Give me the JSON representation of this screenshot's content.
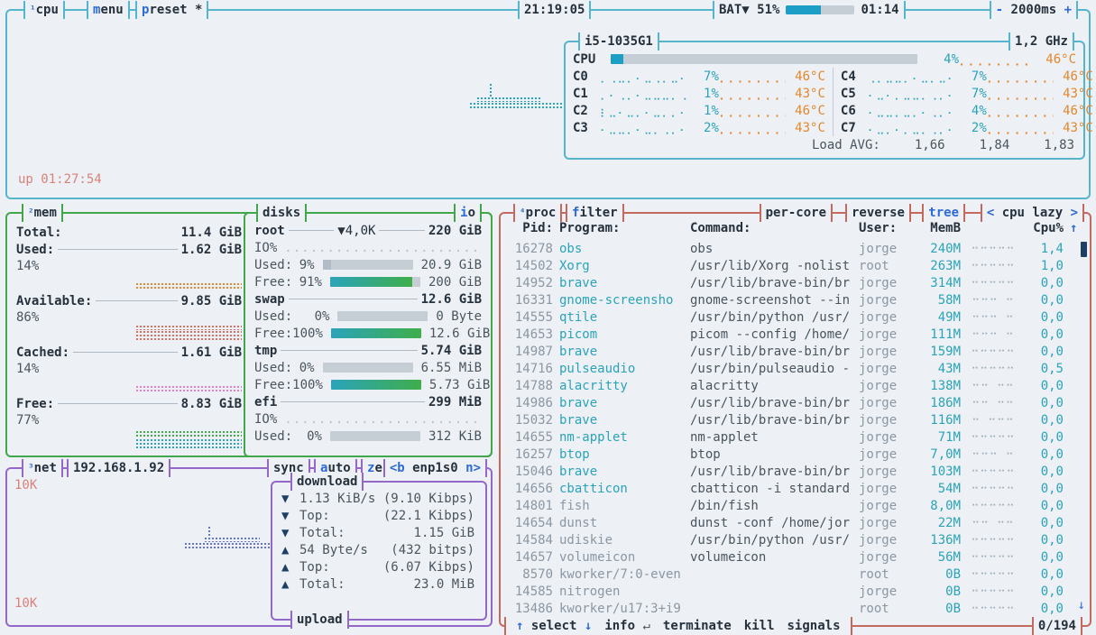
{
  "colors": {
    "bg": "#edf0f4",
    "cpu_border": "#55b5cd",
    "mem_border": "#42a74a",
    "net_border": "#9468c8",
    "proc_border": "#c4695d",
    "title": "#25313d",
    "hotkey": "#2e6bd8",
    "teal": "#2ba3ba",
    "orange": "#e2882e",
    "salmon": "#d8827a",
    "text": "#49555f",
    "grey": "#8a97a4",
    "dots": "#9cabb8",
    "track": "#c5cdd5",
    "green": "#3fae4a",
    "pink": "#e87fc0",
    "red": "#e06c60",
    "navy": "#1d3f66",
    "netblue": "#6674d8"
  },
  "header": {
    "num": "¹",
    "title": "cpu",
    "menu_hot": "m",
    "menu_rest": "enu",
    "preset_hot": "p",
    "preset_rest": "reset *",
    "clock": "21:19:05",
    "battery_label": "BAT▼",
    "battery_pct": "51%",
    "battery_fill": 51,
    "battery_time": "01:14",
    "interval_minus": "-",
    "interval_value": "2000ms",
    "interval_plus": "+"
  },
  "cpu": {
    "model": "i5-1035G1",
    "freq": "1,2 GHz",
    "uptime": "up 01:27:54",
    "total": {
      "label": "CPU",
      "pct": "4%",
      "temp": "46°C",
      "fill": 4,
      "meter": "⡀⡀⡀⡀⡀⡀⡀⡀⡀"
    },
    "cores_left": [
      {
        "label": "C0",
        "graph": "⡀⢀⣀⡀⠄⣀⢀⡀⣀⠄",
        "pct": "7%",
        "meter": "⡀⡀⡀⡀⡀⡀⡀⡀⡀",
        "temp": "46°C"
      },
      {
        "label": "C1",
        "graph": "⡀⠄⢀⡀⠄⣀⣀⣀⡀⢀",
        "pct": "1%",
        "meter": "⡀⡀⡀⡀⡀⡀⡀⡀⡀",
        "temp": "43°C"
      },
      {
        "label": "C2",
        "graph": "⡆⣀⠄⣀⡀⠄⣀⡀⡀⠄",
        "pct": "1%",
        "meter": "⡀⡀⡀⡀⡀⡀⡀⡀⡀",
        "temp": "46°C"
      },
      {
        "label": "C3",
        "graph": "⠄⣀⣀⡀⠄⣀⡀⢀⡀⠄",
        "pct": "2%",
        "meter": "⡀⡀⡀⡀⡀⡀⡀⡀⡀",
        "temp": "43°C"
      }
    ],
    "cores_right": [
      {
        "label": "C4",
        "graph": "⢀⡀⣀⣀⡀⠄⣀⡀⣀⠄",
        "pct": "7%",
        "meter": "⡀⡀⡀⡀⡀⡀⡀⡀⡀",
        "temp": "46°C"
      },
      {
        "label": "C5",
        "graph": "⠄⣀⠄⡀⣀⣀⡀⢀⡀⠄",
        "pct": "7%",
        "meter": "⡀⡀⡀⡀⡀⡀⡀⡀⡀",
        "temp": "43°C"
      },
      {
        "label": "C6",
        "graph": "⠄⣀⣀⡀⣀⡀⠄⢀⡀⠄",
        "pct": "4%",
        "meter": "⡀⡀⡀⡀⡀⡀⡀⡀⡀",
        "temp": "46°C"
      },
      {
        "label": "C7",
        "graph": "⠄⣀⡀⠄⡀⣀⡀⢀⡀⠄",
        "pct": "2%",
        "meter": "⡀⡀⡀⡀⡀⡀⡀⡀⡀",
        "temp": "43°C"
      }
    ],
    "load_label": "Load AVG:",
    "load_values": [
      "1,66",
      "1,84",
      "1,83"
    ]
  },
  "mem": {
    "num": "²",
    "title": "mem",
    "total_label": "Total:",
    "total": "11.4 GiB",
    "sections": [
      {
        "label": "Used:",
        "value": "1.62 GiB",
        "pct": "14%",
        "style": "used"
      },
      {
        "label": "Available:",
        "value": "9.85 GiB",
        "pct": "86%",
        "style": "available"
      },
      {
        "label": "Cached:",
        "value": "1.61 GiB",
        "pct": "14%",
        "style": "cached"
      },
      {
        "label": "Free:",
        "value": "8.83 GiB",
        "pct": "77%",
        "style": "free"
      }
    ]
  },
  "disks": {
    "title": "disks",
    "io_hot": "i",
    "io_rest": "o",
    "items": [
      {
        "name": "root",
        "extra": "▼4,0K",
        "size": "220 GiB",
        "has_io": true,
        "io_label": "IO%",
        "io_dots": "....................................",
        "used_label": "Used:",
        "used_pct": "9%",
        "used_fill": 9,
        "used_val": "20.9 GiB",
        "has_free": true,
        "free_label": "Free:",
        "free_pct": "91%",
        "free_fill": 91,
        "free_val": "200 GiB"
      },
      {
        "name": "swap",
        "size": "12.6 GiB",
        "used_label": "Used:",
        "used_pct": "0%",
        "used_fill": 0,
        "used_val": "0 Byte",
        "has_free": true,
        "free_label": "Free:",
        "free_pct": "100%",
        "free_fill": 100,
        "free_val": "12.6 GiB"
      },
      {
        "name": "tmp",
        "size": "5.74 GiB",
        "used_label": "Used:",
        "used_pct": "0%",
        "used_fill": 0,
        "used_val": "6.55 MiB",
        "has_free": true,
        "free_label": "Free:",
        "free_pct": "100%",
        "free_fill": 100,
        "free_val": "5.73 GiB"
      },
      {
        "name": "efi",
        "size": "299 MiB",
        "has_io": true,
        "io_label": "IO%",
        "io_dots": "....................................",
        "used_label": "Used:",
        "used_pct": "0%",
        "used_fill": 0,
        "used_val": "312 KiB"
      }
    ]
  },
  "net": {
    "num": "³",
    "title": "net",
    "ip": "192.168.1.92",
    "sync": "sync",
    "auto_hot": "a",
    "auto_rest": "uto",
    "zero_hot": "z",
    "zero_rest": "ero",
    "iface_prev": "<b",
    "iface": "enp1s0",
    "iface_next": "n>",
    "scale_top": "10K",
    "scale_bottom": "10K",
    "download_title": "download",
    "upload_title": "upload",
    "rows": [
      {
        "arrow": "▼",
        "label": "1.13 KiB/s",
        "value": "(9.10 Kibps)"
      },
      {
        "arrow": "▼",
        "label": "Top:",
        "value": "(22.1 Kibps)"
      },
      {
        "arrow": "▼",
        "label": "Total:",
        "value": "1.15 GiB"
      },
      {
        "arrow": "▲",
        "label": "54 Byte/s",
        "value": "(432 bitps)"
      },
      {
        "arrow": "▲",
        "label": "Top:",
        "value": "(6.07 Kibps)"
      },
      {
        "arrow": "▲",
        "label": "Total:",
        "value": "23.0 MiB"
      }
    ]
  },
  "proc": {
    "num": "⁴",
    "title": "proc",
    "filter_hot": "f",
    "filter_rest": "ilter",
    "percore": "per-core",
    "reverse": "reverse",
    "tree": "tree",
    "sort_prev": "<",
    "sort_label": "cpu lazy",
    "sort_next": ">",
    "columns": {
      "pid": "Pid:",
      "program": "Program:",
      "command": "Command:",
      "user": "User:",
      "mem": "MemB",
      "cpu": "Cpu%",
      "sort_arrow": "↑"
    },
    "scroll_down": "↓",
    "rows": [
      {
        "pid": "16278",
        "program": "obs",
        "command": "obs",
        "user": "jorge",
        "mem": "240M",
        "graph": "⠒⠒⠒⠒⠒",
        "cpu": "1,4"
      },
      {
        "pid": "14502",
        "program": "Xorg",
        "command": "/usr/lib/Xorg -nolist",
        "user": "root",
        "mem": "263M",
        "graph": "⠒⠒⠒⠒⠒",
        "cpu": "1,0"
      },
      {
        "pid": "14952",
        "program": "brave",
        "command": "/usr/lib/brave-bin/br",
        "user": "jorge",
        "mem": "314M",
        "graph": "⠒⠒⠒⠒⠒",
        "cpu": "0,0"
      },
      {
        "pid": "16331",
        "program": "gnome-screensho",
        "command": "gnome-screenshot --in",
        "user": "jorge",
        "mem": "58M",
        "graph": "⠒⠒⠒ ⠒",
        "cpu": "0,0"
      },
      {
        "pid": "14555",
        "program": "qtile",
        "command": "/usr/bin/python /usr/",
        "user": "jorge",
        "mem": "49M",
        "graph": "⠒⠒⠒ ⠒",
        "cpu": "0,0"
      },
      {
        "pid": "14653",
        "program": "picom",
        "command": "picom --config /home/",
        "user": "jorge",
        "mem": "111M",
        "graph": "⠒⠒⠒ ⠒",
        "cpu": "0,0"
      },
      {
        "pid": "14987",
        "program": "brave",
        "command": "/usr/lib/brave-bin/br",
        "user": "jorge",
        "mem": "159M",
        "graph": "⠒⠒⠒⠒⠒",
        "cpu": "0,0"
      },
      {
        "pid": "14716",
        "program": "pulseaudio",
        "command": "/usr/bin/pulseaudio -",
        "user": "jorge",
        "mem": "43M",
        "graph": "⠒⠒⠒⠒⠒",
        "cpu": "0,5"
      },
      {
        "pid": "14788",
        "program": "alacritty",
        "command": "alacritty",
        "user": "jorge",
        "mem": "138M",
        "graph": "⠒⠒ ⠒⠒",
        "cpu": "0,0"
      },
      {
        "pid": "14986",
        "program": "brave",
        "command": "/usr/lib/brave-bin/br",
        "user": "jorge",
        "mem": "186M",
        "graph": "⠒⠒ ⠒⠒",
        "cpu": "0,0"
      },
      {
        "pid": "15032",
        "program": "brave",
        "command": "/usr/lib/brave-bin/br",
        "user": "jorge",
        "mem": "116M",
        "graph": "⠒ ⠒⠒⠒",
        "cpu": "0,0"
      },
      {
        "pid": "14655",
        "program": "nm-applet",
        "command": "nm-applet",
        "user": "jorge",
        "mem": "71M",
        "graph": "⠒⠒⠒⠒⠒",
        "cpu": "0,0"
      },
      {
        "pid": "16257",
        "program": "btop",
        "command": "btop",
        "user": "jorge",
        "mem": "7,0M",
        "graph": "⠒⠒⠒ ⠒",
        "cpu": "0,0"
      },
      {
        "pid": "15046",
        "program": "brave",
        "command": "/usr/lib/brave-bin/br",
        "user": "jorge",
        "mem": "103M",
        "graph": "⠒⠒⠒⠒⠒",
        "cpu": "0,0"
      },
      {
        "pid": "14656",
        "program": "cbatticon",
        "command": "cbatticon -i standard",
        "user": "jorge",
        "mem": "54M",
        "graph": "⠒⠒⠒⠒⠒",
        "cpu": "0,0"
      },
      {
        "pid": "14801",
        "program": "fish",
        "command": "/bin/fish",
        "user": "jorge",
        "mem": "8,0M",
        "graph": "⠒⠒⠒⠒⠒",
        "cpu": "0,0"
      },
      {
        "pid": "14654",
        "program": "dunst",
        "command": "dunst -conf /home/jor",
        "user": "jorge",
        "mem": "22M",
        "graph": "⠒⠒ ⠒⠒",
        "cpu": "0,0"
      },
      {
        "pid": "14584",
        "program": "udiskie",
        "command": "/usr/bin/python /usr/",
        "user": "jorge",
        "mem": "136M",
        "graph": "⠒⠒⠒⠒⠒",
        "cpu": "0,0"
      },
      {
        "pid": "14657",
        "program": "volumeicon",
        "command": "volumeicon",
        "user": "jorge",
        "mem": "56M",
        "graph": "⠒⠒⠒⠒⠒",
        "cpu": "0,0"
      },
      {
        "pid": "8570",
        "program": "kworker/7:0-even",
        "command": "",
        "user": "root",
        "mem": "0B",
        "graph": "⠒⠒⠒⠒⠒",
        "cpu": "0,0"
      },
      {
        "pid": "14585",
        "program": "nitrogen",
        "command": "",
        "user": "jorge",
        "mem": "0B",
        "graph": "⠒⠒⠒⠒⠒",
        "cpu": "0,0"
      },
      {
        "pid": "13486",
        "program": "kworker/u17:3+i9",
        "command": "",
        "user": "root",
        "mem": "0B",
        "graph": "⠒⠒⠒⠒⠒",
        "cpu": "0,0"
      }
    ]
  },
  "footer": {
    "up": "↑",
    "select": "select",
    "down": "↓",
    "info": "info",
    "enter": "↵",
    "terminate": "terminate",
    "kill": "kill",
    "signals": "signals",
    "count": "0/194"
  }
}
